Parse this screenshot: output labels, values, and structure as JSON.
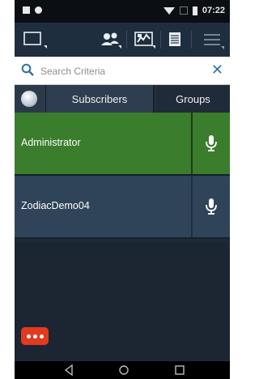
{
  "status_bar": {
    "time": "07:22"
  },
  "search": {
    "placeholder": "Search Criteria",
    "value": ""
  },
  "tabs": {
    "subscribers_label": "Subscribers",
    "groups_label": "Groups"
  },
  "contacts": [
    {
      "name": "Administrator",
      "selected": true
    },
    {
      "name": "ZodiacDemo04",
      "selected": false
    }
  ],
  "icons": {
    "toolbar": [
      "window-icon",
      "contacts-icon",
      "map-icon",
      "list-icon",
      "menu-icon"
    ],
    "row_action": "microphone-icon",
    "more": "more-dots-icon",
    "nav": [
      "back-icon",
      "home-icon",
      "recents-icon"
    ]
  },
  "colors": {
    "selected_row": "#3a7d2c",
    "row": "#2f4458",
    "accent": "#2e6fb1",
    "more_button": "#e23a1e"
  }
}
